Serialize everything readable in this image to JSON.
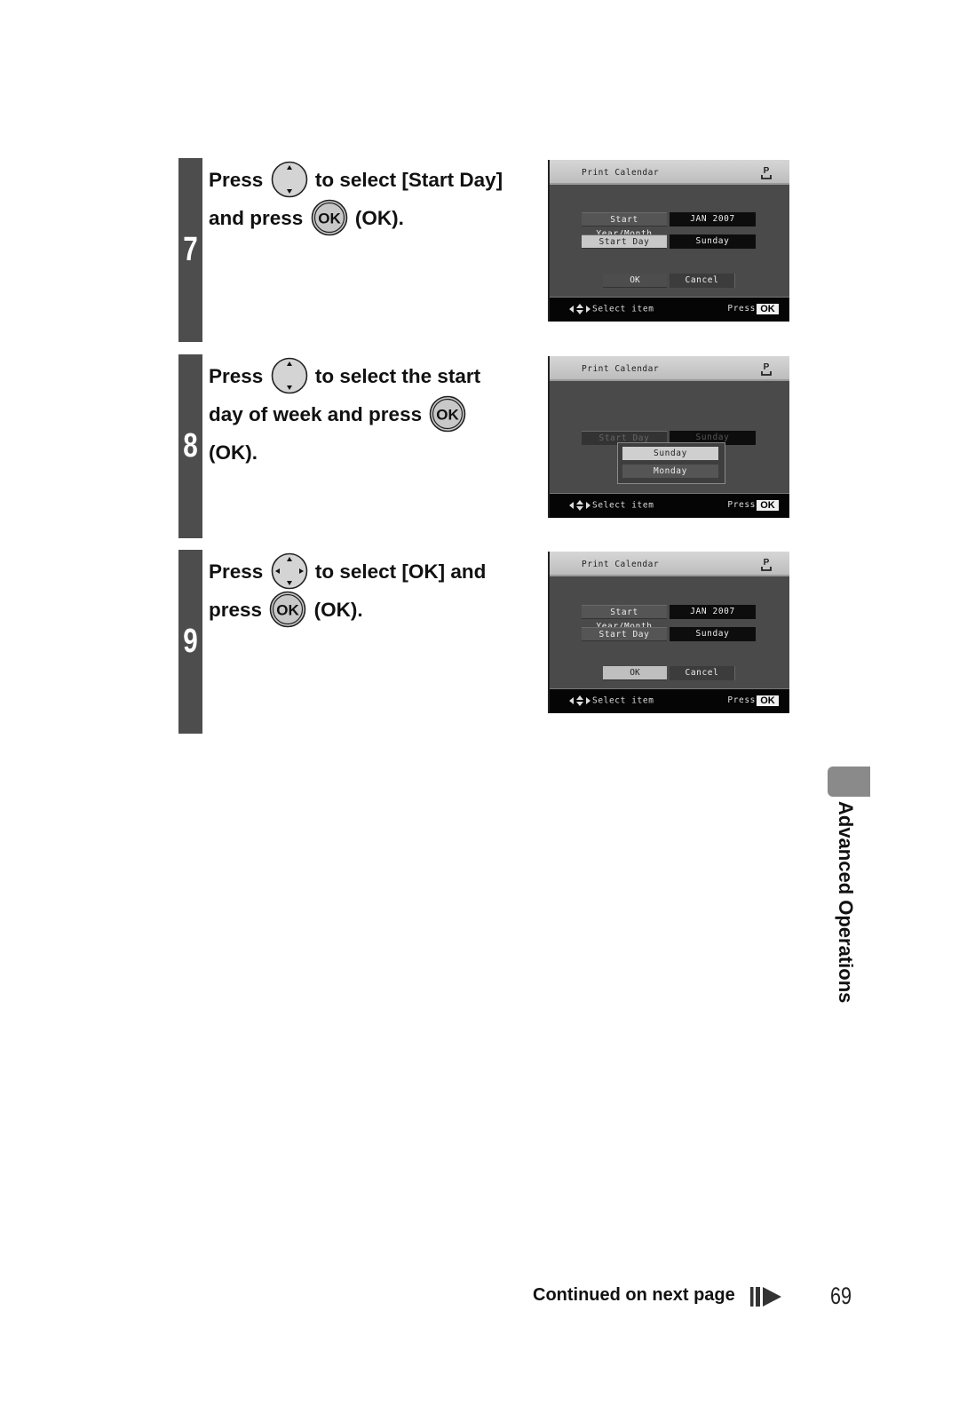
{
  "steps": [
    {
      "number": "7",
      "text_parts": [
        "Press",
        "to select [Start Day]",
        "and press",
        "(OK)."
      ],
      "icons": [
        "updown-button-icon",
        "ok-button-icon"
      ],
      "screen": {
        "title": "Print Calendar",
        "rows": [
          {
            "label": "Start Year/Month",
            "value": "JAN 2007",
            "selected": false
          },
          {
            "label": "Start Day",
            "value": "Sunday",
            "selected": true
          }
        ],
        "ok_label": "OK",
        "cancel_label": "Cancel",
        "ok_selected": false,
        "footer_nav": "Select item",
        "footer_press": "Press",
        "footer_ok": "OK"
      }
    },
    {
      "number": "8",
      "text_parts": [
        "Press",
        "to select the start",
        "day of week and press",
        "(OK)."
      ],
      "icons": [
        "updown-button-icon",
        "ok-button-icon"
      ],
      "screen": {
        "title": "Print Calendar",
        "rows": [
          {
            "label": "Start Day",
            "value": "Sunday",
            "selected": false
          }
        ],
        "popup_options": [
          {
            "label": "Sunday",
            "selected": true
          },
          {
            "label": "Monday",
            "selected": false
          }
        ],
        "footer_nav": "Select item",
        "footer_press": "Press",
        "footer_ok": "OK"
      }
    },
    {
      "number": "9",
      "text_parts": [
        "Press",
        "to select [OK] and",
        "press",
        "(OK)."
      ],
      "icons": [
        "four-way-button-icon",
        "ok-button-icon"
      ],
      "screen": {
        "title": "Print Calendar",
        "rows": [
          {
            "label": "Start Year/Month",
            "value": "JAN 2007",
            "selected": false
          },
          {
            "label": "Start Day",
            "value": "Sunday",
            "selected": false
          }
        ],
        "ok_label": "OK",
        "cancel_label": "Cancel",
        "ok_selected": true,
        "footer_nav": "Select item",
        "footer_press": "Press",
        "footer_ok": "OK"
      }
    }
  ],
  "ok_icon_label": "OK",
  "side_tab": {
    "label": "Advanced Operations",
    "color": "#8a8a8a"
  },
  "footer": {
    "continued": "Continued on next page",
    "page_number": "69"
  },
  "colors": {
    "step_bar": "#4d4d4d",
    "screen_bg": "#4a4a4a",
    "screen_footer": "#050505"
  }
}
